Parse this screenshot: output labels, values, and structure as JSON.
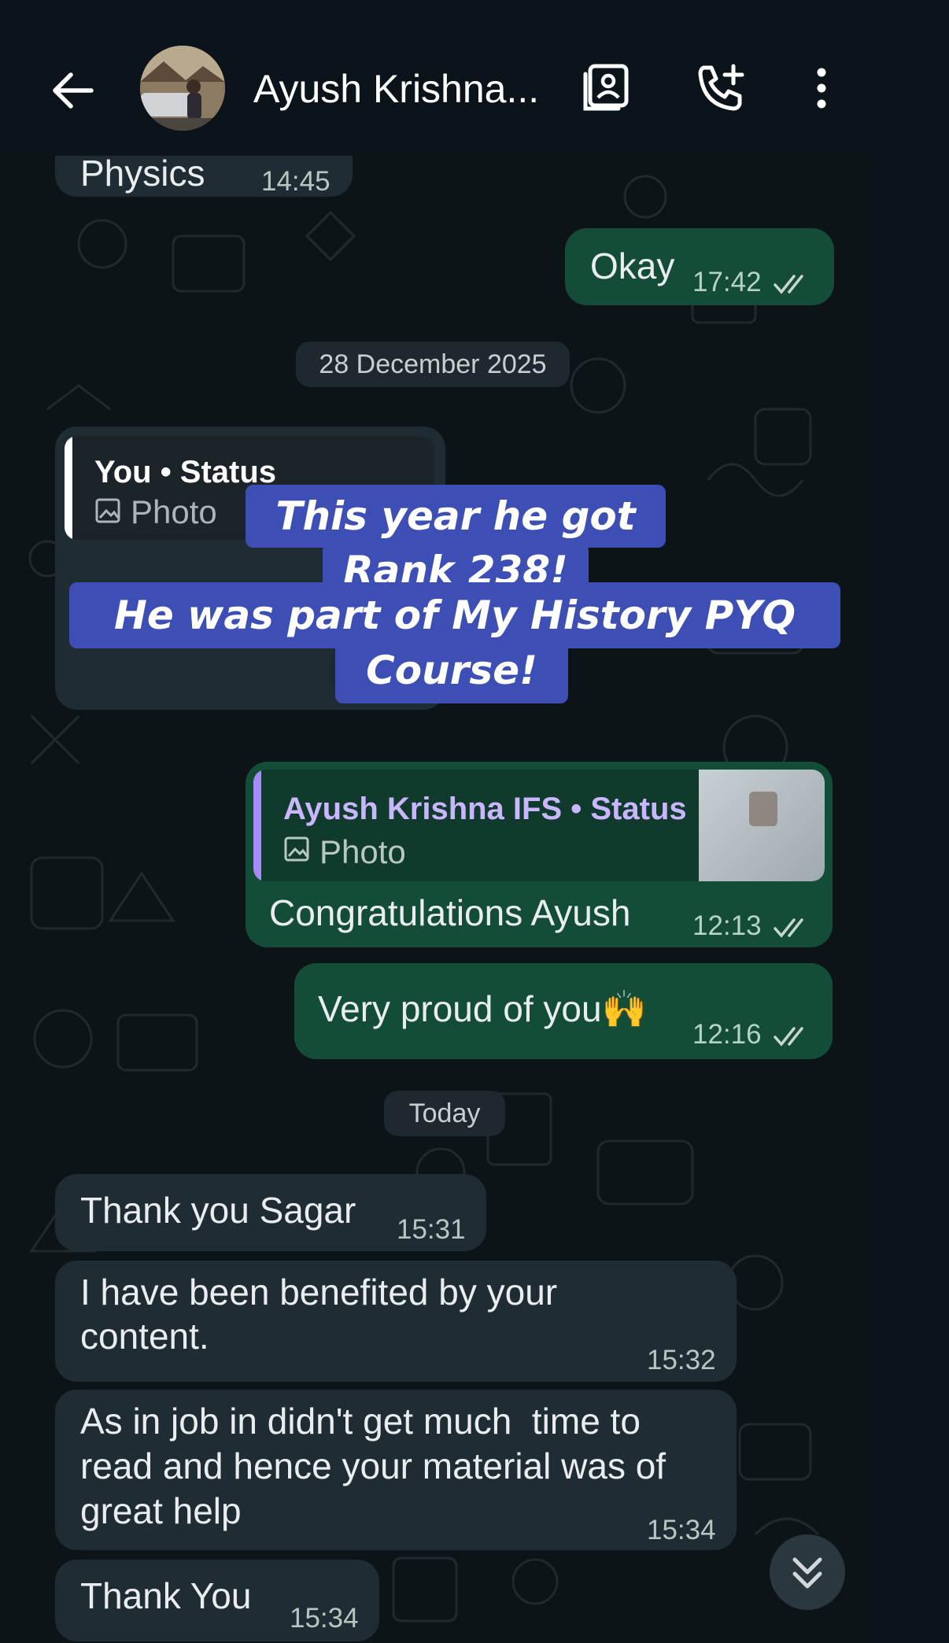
{
  "header": {
    "contact_name": "Ayush Krishna...",
    "icons": [
      "back-arrow-icon",
      "avatar",
      "contact-card-icon",
      "add-call-icon",
      "more-vert-icon"
    ]
  },
  "messages": {
    "m1": {
      "text": "Physics",
      "time": "14:45"
    },
    "m2": {
      "text": "Okay",
      "time": "17:42"
    },
    "date1": "28 December 2025",
    "m3": {
      "quote_author": "You • Status",
      "quote_type": "Photo"
    },
    "m5": {
      "quote_author": "Ayush Krishna IFS • Status",
      "quote_type": "Photo",
      "text": "Congratulations Ayush",
      "time": "12:13"
    },
    "m6": {
      "text": "Very proud of you🙌",
      "time": "12:16"
    },
    "date2": "Today",
    "m7": {
      "text": "Thank you Sagar",
      "time": "15:31"
    },
    "m8": {
      "line1": "I have been benefited by your",
      "line2": "content.",
      "time": "15:32"
    },
    "m9": {
      "line1": "As in job in didn't get much  time to",
      "line2": "read and hence your material was of",
      "line3": "great help",
      "time": "15:34"
    },
    "m10": {
      "text": "Thank You",
      "time": "15:34"
    }
  },
  "overlay": {
    "line1": "This year he got",
    "line2": "Rank 238!",
    "line3": "He was part of My History PYQ",
    "line4": "Course!"
  },
  "colors": {
    "background": "#0b141a",
    "incoming_bubble": "#202c33",
    "outgoing_bubble": "#144d37",
    "overlay": "#3d4fb5",
    "quote_bar_in": "#ffffff",
    "quote_bar_out": "#a78bfa"
  }
}
